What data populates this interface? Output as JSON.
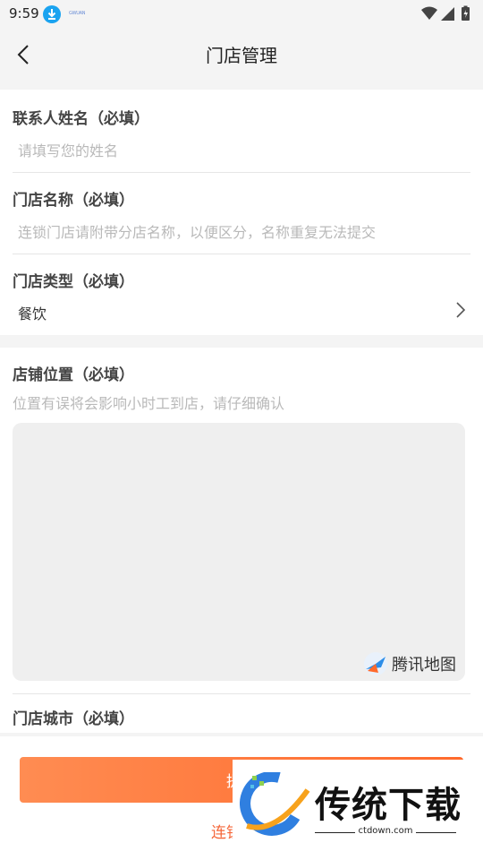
{
  "status": {
    "time": "9:59",
    "app_label": "GWUAN"
  },
  "nav": {
    "title": "门店管理"
  },
  "form": {
    "contact": {
      "label": "联系人姓名（必填）",
      "placeholder": "请填写您的姓名"
    },
    "store_name": {
      "label": "门店名称（必填）",
      "placeholder": "连锁门店请附带分店名称，以便区分，名称重复无法提交"
    },
    "store_type": {
      "label": "门店类型（必填）",
      "value": "餐饮"
    },
    "location": {
      "label": "店铺位置（必填）",
      "hint": "位置有误将会影响小时工到店，请仔细确认"
    },
    "map_logo": "腾讯地图",
    "city": {
      "label": "门店城市（必填）"
    }
  },
  "actions": {
    "submit_label": "提交",
    "chain_link_label": "连锁门店"
  },
  "watermark": {
    "text": "传统下载",
    "url": "ctdown.com"
  },
  "colors": {
    "accent": "#ff6a2c",
    "link": "#f5673a",
    "status_download": "#1aa3f0"
  },
  "icons": {
    "back": "chevron-left-icon",
    "chevron": "chevron-right-icon",
    "download": "download-icon",
    "wifi": "wifi-icon",
    "signal": "signal-icon",
    "battery": "battery-icon"
  }
}
